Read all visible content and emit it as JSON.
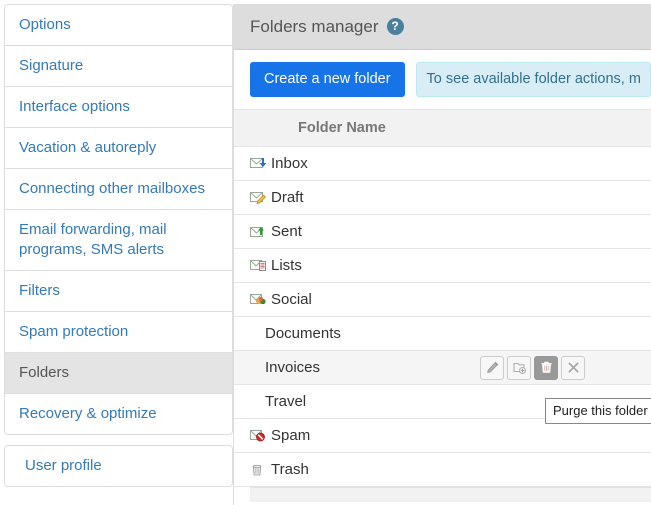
{
  "sidebar": {
    "groups": [
      {
        "items": [
          {
            "label": "Options",
            "active": false,
            "indent": false
          },
          {
            "label": "Signature",
            "active": false,
            "indent": false
          },
          {
            "label": "Interface options",
            "active": false,
            "indent": false
          },
          {
            "label": "Vacation & autoreply",
            "active": false,
            "indent": false
          },
          {
            "label": "Connecting other mailboxes",
            "active": false,
            "indent": false
          },
          {
            "label": "Email forwarding, mail programs, SMS alerts",
            "active": false,
            "indent": false
          },
          {
            "label": "Filters",
            "active": false,
            "indent": false
          },
          {
            "label": "Spam protection",
            "active": false,
            "indent": false
          },
          {
            "label": "Folders",
            "active": true,
            "indent": false
          },
          {
            "label": "Recovery & optimize",
            "active": false,
            "indent": false
          }
        ]
      },
      {
        "items": [
          {
            "label": "User profile",
            "active": false,
            "indent": true
          }
        ]
      }
    ]
  },
  "main": {
    "title": "Folders manager",
    "help_icon": "question-mark-icon",
    "toolbar": {
      "create_label": "Create a new folder",
      "info_text": "To see available folder actions, m"
    },
    "table": {
      "column_header": "Folder Name",
      "rows": [
        {
          "name": "Inbox",
          "icon": "inbox-envelope-icon",
          "sub": false,
          "hover": false,
          "actions": false
        },
        {
          "name": "Draft",
          "icon": "draft-envelope-icon",
          "sub": false,
          "hover": false,
          "actions": false
        },
        {
          "name": "Sent",
          "icon": "sent-envelope-icon",
          "sub": false,
          "hover": false,
          "actions": false
        },
        {
          "name": "Lists",
          "icon": "lists-envelope-icon",
          "sub": false,
          "hover": false,
          "actions": false
        },
        {
          "name": "Social",
          "icon": "social-envelope-icon",
          "sub": false,
          "hover": false,
          "actions": false
        },
        {
          "name": "Documents",
          "icon": "none",
          "sub": true,
          "hover": false,
          "actions": false
        },
        {
          "name": "Invoices",
          "icon": "none",
          "sub": true,
          "hover": true,
          "actions": true
        },
        {
          "name": "Travel",
          "icon": "none",
          "sub": true,
          "hover": false,
          "actions": false
        },
        {
          "name": "Spam",
          "icon": "spam-envelope-icon",
          "sub": false,
          "hover": false,
          "actions": false
        },
        {
          "name": "Trash",
          "icon": "trash-can-icon",
          "sub": false,
          "hover": false,
          "actions": false
        }
      ],
      "row_actions": [
        {
          "name": "edit-folder-button",
          "icon": "pencil-icon",
          "active": false
        },
        {
          "name": "new-subfolder-button",
          "icon": "folder-plus-icon",
          "active": false
        },
        {
          "name": "purge-folder-button",
          "icon": "trash-icon",
          "active": true
        },
        {
          "name": "delete-folder-button",
          "icon": "close-x-icon",
          "active": false
        }
      ]
    },
    "tooltip": "Purge this folder"
  },
  "colors": {
    "accent_blue": "#1774e8",
    "link_blue": "#337ab7",
    "info_bg": "#d9edf7",
    "info_text": "#31708f",
    "header_gray": "#dddddd",
    "active_item": "#e4e4e4"
  }
}
